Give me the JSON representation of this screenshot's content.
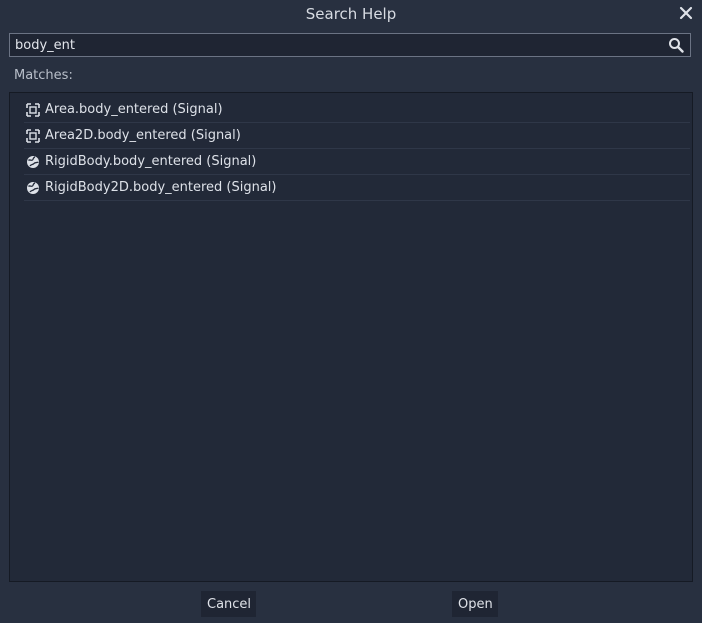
{
  "dialog": {
    "title": "Search Help",
    "close_icon": "close-icon"
  },
  "search": {
    "value": "body_ent",
    "placeholder": "",
    "icon": "search-icon"
  },
  "matches_label": "Matches:",
  "results": [
    {
      "label": "Area.body_entered (Signal)",
      "icon": "area-node-icon"
    },
    {
      "label": "Area2D.body_entered (Signal)",
      "icon": "area-node-icon"
    },
    {
      "label": "RigidBody.body_entered (Signal)",
      "icon": "rigid-body-icon"
    },
    {
      "label": "RigidBody2D.body_entered (Signal)",
      "icon": "rigid-body-icon"
    }
  ],
  "buttons": {
    "cancel": "Cancel",
    "open": "Open"
  }
}
